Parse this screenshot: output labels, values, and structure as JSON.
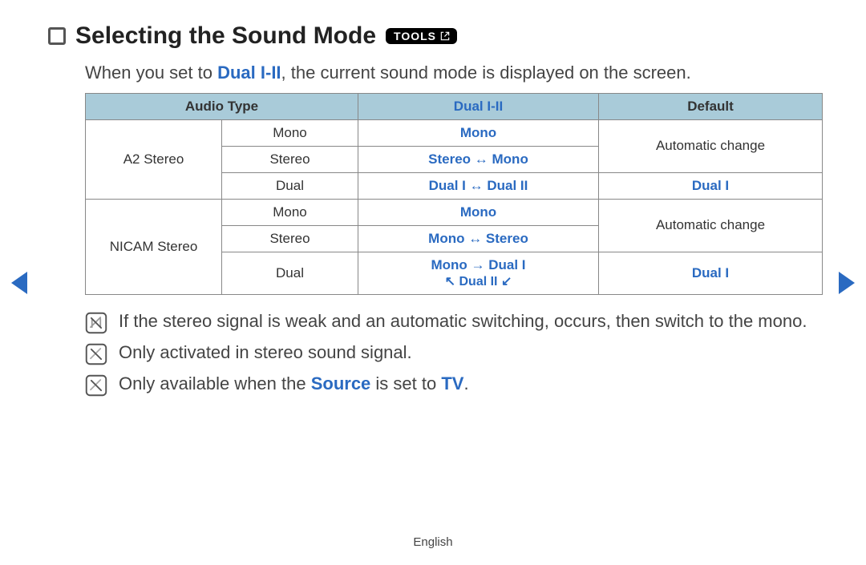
{
  "heading": "Selecting the Sound Mode",
  "tools_label": "TOOLS",
  "intro_pre": "When you set to ",
  "intro_key": "Dual I-II",
  "intro_post": ", the current sound mode is displayed on the screen.",
  "table": {
    "headers": {
      "audio_type": "Audio Type",
      "dual": "Dual I-II",
      "default": "Default"
    },
    "group1": {
      "name": "A2 Stereo",
      "row1": {
        "type": "Mono",
        "dual": "Mono",
        "default": "Automatic change"
      },
      "row2": {
        "type": "Stereo",
        "dual": "Stereo ↔ Mono"
      },
      "row3": {
        "type": "Dual",
        "dual": "Dual I ↔ Dual II",
        "default": "Dual I"
      }
    },
    "group2": {
      "name": "NICAM Stereo",
      "row1": {
        "type": "Mono",
        "dual": "Mono",
        "default": "Automatic change"
      },
      "row2": {
        "type": "Stereo",
        "dual": "Mono ↔ Stereo"
      },
      "row3": {
        "type": "Dual",
        "dual_line1": "Mono → Dual I",
        "dual_line2": "↖ Dual II ↙",
        "default": "Dual I"
      }
    }
  },
  "notes": {
    "n1": "If the stereo signal is weak and an automatic switching, occurs, then switch to the mono.",
    "n2": "Only activated in stereo sound signal.",
    "n3_pre": "Only available when the ",
    "n3_key1": "Source",
    "n3_mid": " is set to ",
    "n3_key2": "TV",
    "n3_post": "."
  },
  "footer": "English"
}
